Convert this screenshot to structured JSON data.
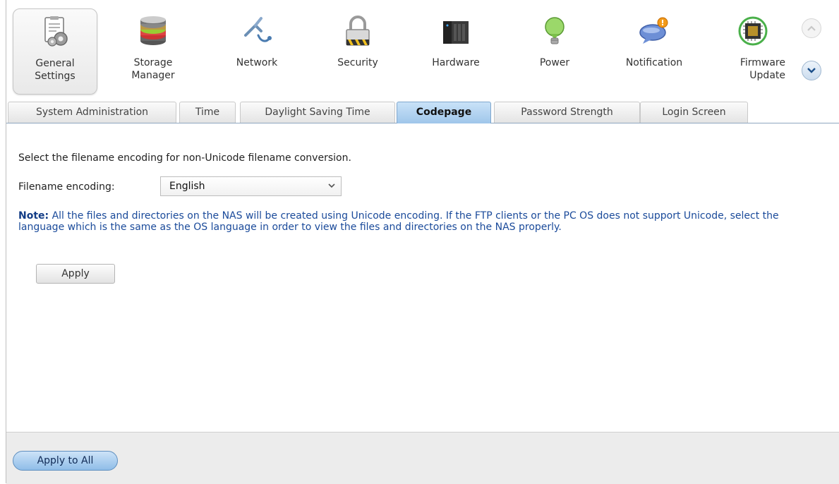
{
  "categories": [
    {
      "label": "General\nSettings",
      "icon": "general-settings-icon"
    },
    {
      "label": "Storage\nManager",
      "icon": "storage-manager-icon"
    },
    {
      "label": "Network",
      "icon": "network-icon"
    },
    {
      "label": "Security",
      "icon": "security-lock-icon"
    },
    {
      "label": "Hardware",
      "icon": "hardware-icon"
    },
    {
      "label": "Power",
      "icon": "power-bulb-icon"
    },
    {
      "label": "Notification",
      "icon": "notification-bubble-icon"
    },
    {
      "label": "Firmware\nUpdate",
      "icon": "firmware-chip-icon"
    }
  ],
  "nav": {
    "scroll_up": "chevron-up-icon",
    "scroll_down": "chevron-down-icon"
  },
  "tabs": [
    {
      "label": "System Administration"
    },
    {
      "label": "Time"
    },
    {
      "label": "Daylight Saving Time"
    },
    {
      "label": "Codepage"
    },
    {
      "label": "Password Strength"
    },
    {
      "label": "Login Screen"
    }
  ],
  "main": {
    "description": "Select the filename encoding for non-Unicode filename conversion.",
    "encoding_label": "Filename encoding:",
    "encoding_value": "English",
    "note_prefix": "Note:",
    "note_text": " All the files and directories on the NAS will be created using Unicode encoding. If the FTP clients or the PC OS does not support Unicode, select the language which is the same as the OS language in order to view the files and directories on the NAS properly.",
    "apply_label": "Apply"
  },
  "footer": {
    "apply_all_label": "Apply to All"
  },
  "colors": {
    "accent": "#9fc6ea",
    "note_text": "#1a4a9a",
    "active_tab_border": "#7fa6cc"
  }
}
